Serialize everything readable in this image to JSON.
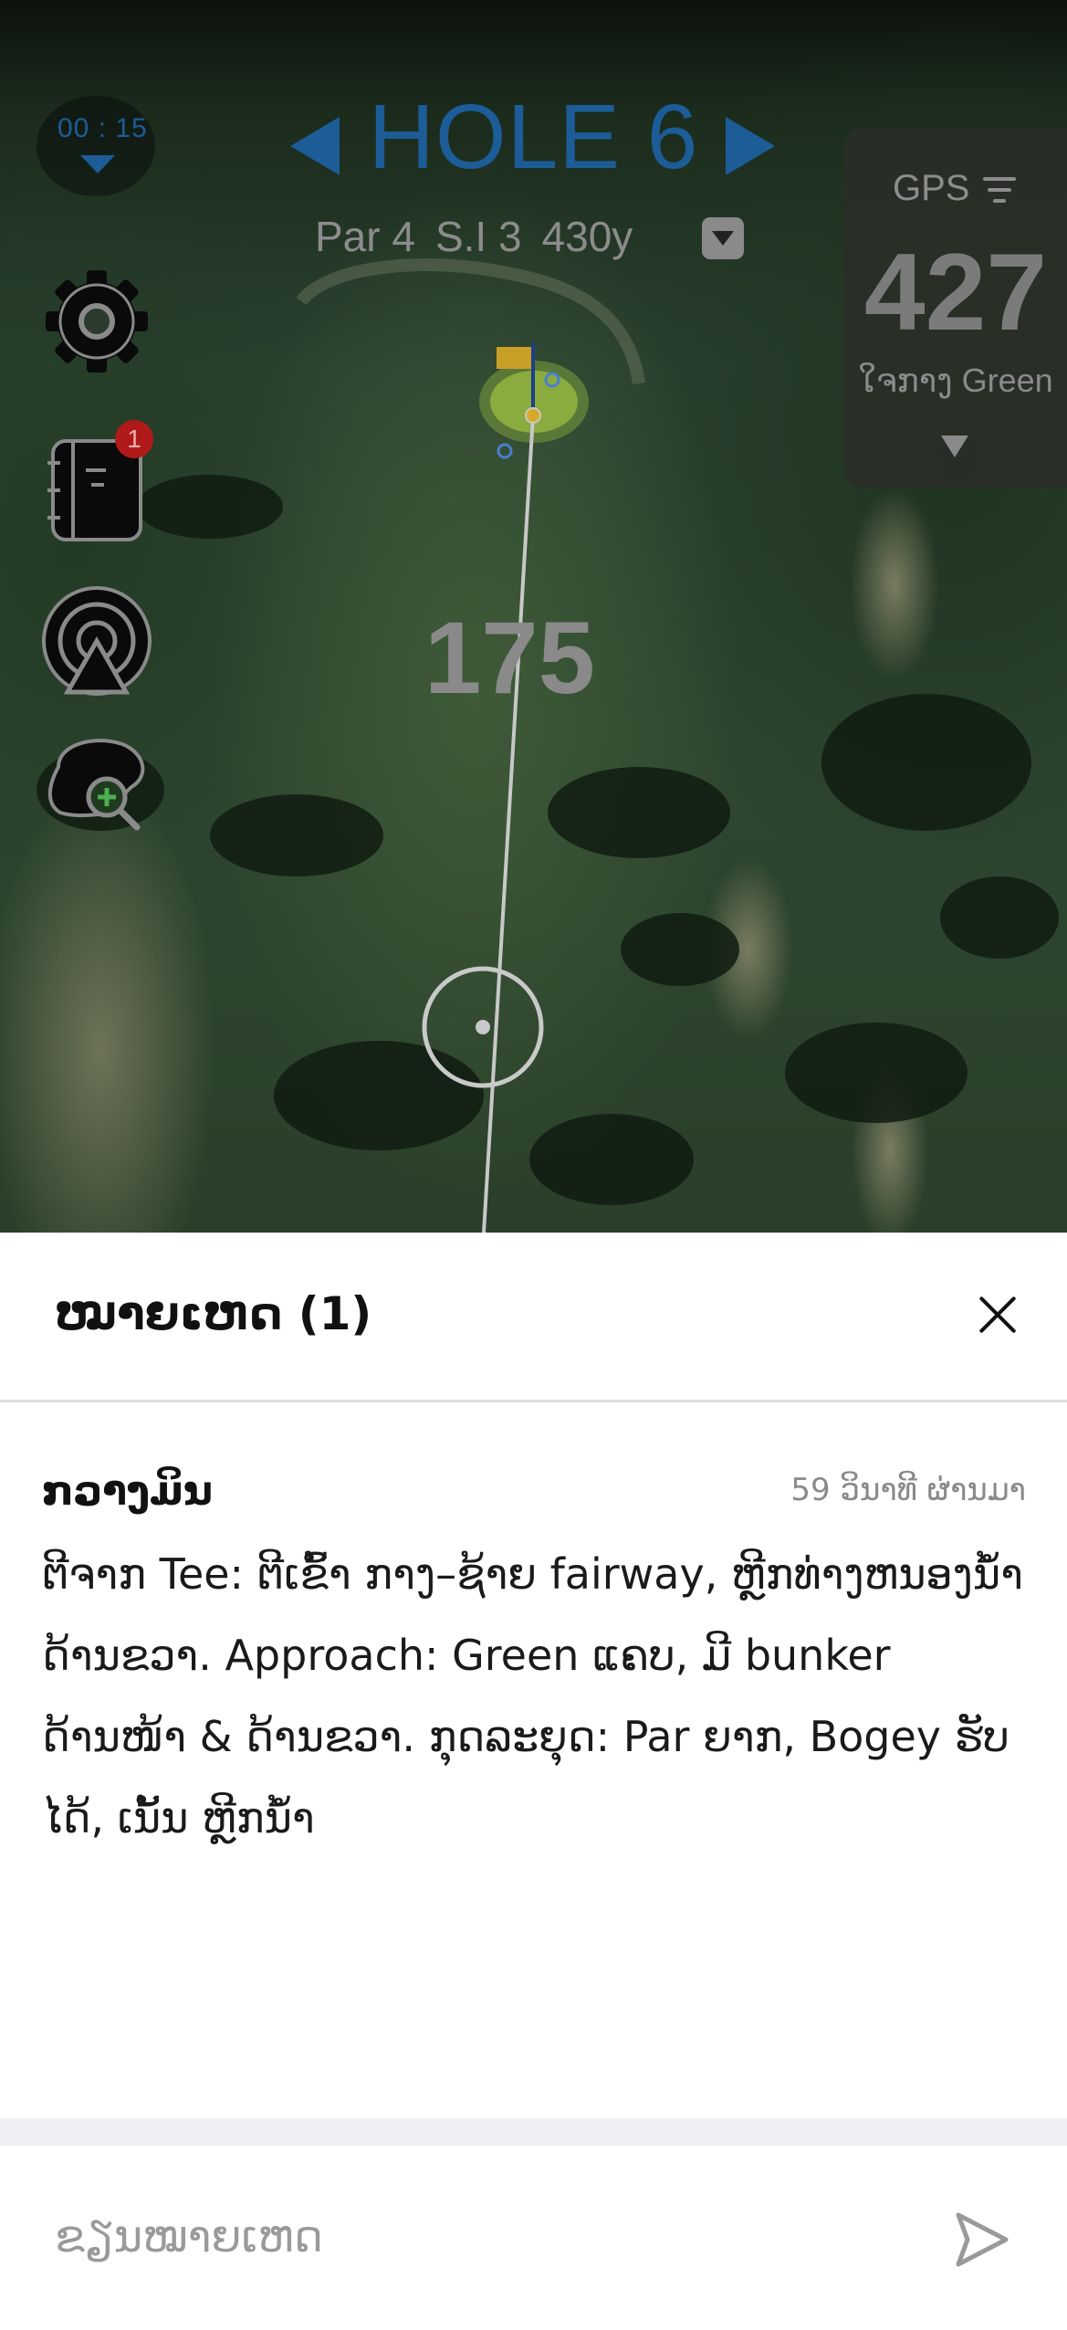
{
  "map": {
    "timer": "00 : 15",
    "hole_title": "HOLE 6",
    "par": "Par 4",
    "stroke_index": "S.I 3",
    "yardage": "430y",
    "gps_label": "GPS",
    "gps_distance": "427",
    "gps_target": "ໃຈກາງ Green",
    "notes_badge_count": "1",
    "shot_distance": "175",
    "accent_color": "#1c5c97"
  },
  "icons": {
    "settings": "gear-icon",
    "notes": "notebook-icon",
    "shot_tracking": "target-signal-icon",
    "zoom": "zoom-in-icon",
    "close": "close-icon",
    "send": "send-icon"
  },
  "sheet": {
    "title": "ໝາຍເຫດ (1)",
    "notes": [
      {
        "author": "ກວາງມິນ",
        "time": "59 ວິນາທີ ຜ່ານມາ",
        "text": "ຕີຈາກ Tee: ຕີເຂົ້າ ກາງ–ຊ້າຍ fairway, ຫຼີກທ່າງຫນອງນ້ຳດ້ານຂວາ. Approach: Green ແຄບ, ມີ bunker ດ້ານໜ້າ & ດ້ານຂວາ. ກຸດລະຍຸດ: Par ຍາກ, Bogey ຮັບໄດ້, ເນັ້ນ ຫຼີກນ້ຳ"
      }
    ],
    "input_placeholder": "ຂຽນໝາຍເຫດ"
  }
}
